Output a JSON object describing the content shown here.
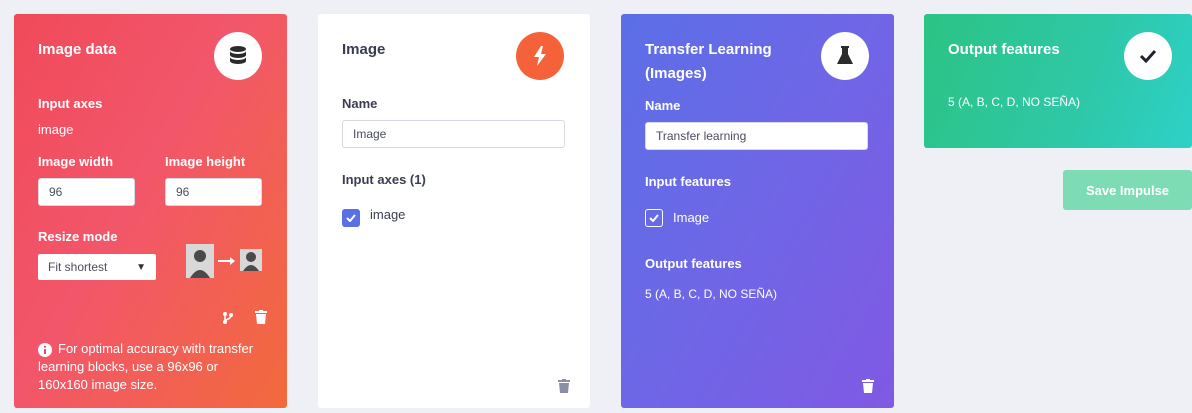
{
  "image_data_card": {
    "title": "Image data",
    "input_axes_label": "Input axes",
    "input_axes_value": "image",
    "width_label": "Image width",
    "width_value": "96",
    "height_label": "Image height",
    "height_value": "96",
    "resize_label": "Resize mode",
    "resize_value": "Fit shortest",
    "info_text": "For optimal accuracy with transfer learning blocks, use a 96x96 or 160x160 image size.",
    "icon": "database-icon",
    "color": "#f04a5a"
  },
  "image_card": {
    "title": "Image",
    "name_label": "Name",
    "name_value": "Image",
    "input_axes_label": "Input axes (1)",
    "axis_item": "image",
    "icon": "lightning-icon",
    "accent": "#f5623a"
  },
  "transfer_card": {
    "title": "Transfer Learning (Images)",
    "name_label": "Name",
    "name_value": "Transfer learning",
    "input_features_label": "Input features",
    "feature_item": "Image",
    "output_features_label": "Output features",
    "output_features_value": "5 (A, B, C, D, NO SEÑA)",
    "icon": "flask-icon",
    "color": "#6a68e6"
  },
  "output_card": {
    "title": "Output features",
    "value": "5 (A, B, C, D, NO SEÑA)",
    "icon": "check-icon",
    "color": "#2ec89a"
  },
  "save_button": "Save Impulse"
}
